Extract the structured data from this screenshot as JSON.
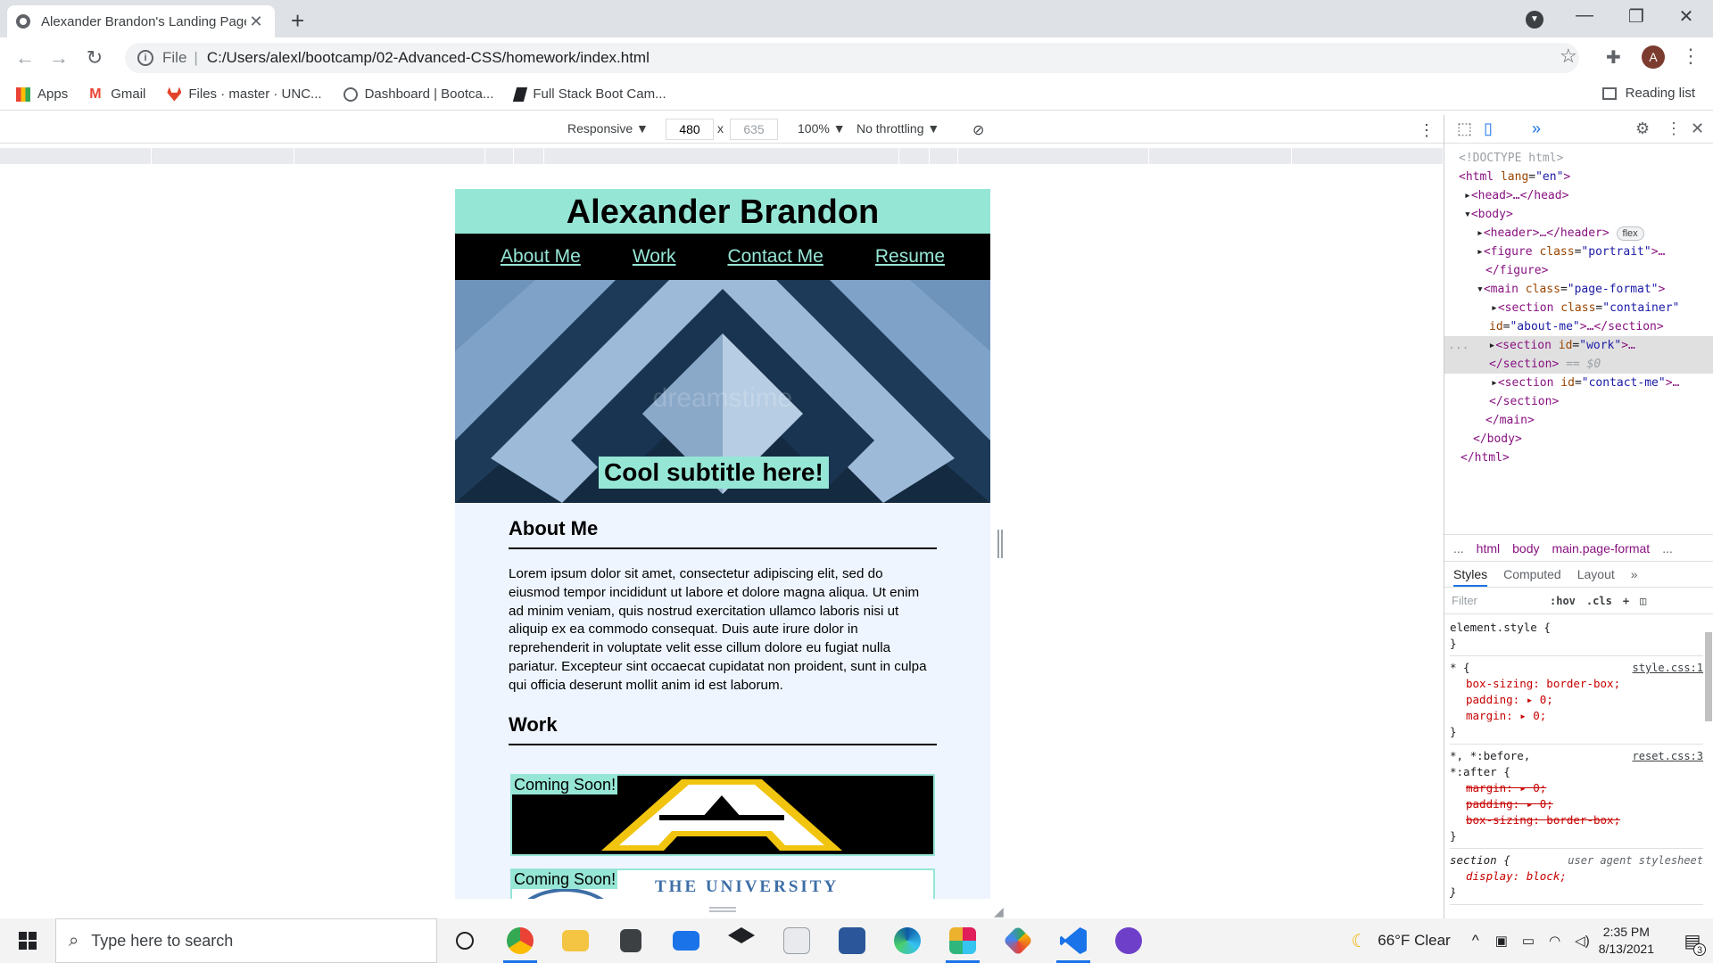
{
  "browser": {
    "tab_title": "Alexander Brandon's Landing Page",
    "url_scheme": "File",
    "url": "C:/Users/alexl/bootcamp/02-Advanced-CSS/homework/index.html",
    "avatar_letter": "A"
  },
  "bookmarks": {
    "items": [
      "Apps",
      "Gmail",
      "Files · master · UNC...",
      "Dashboard | Bootca...",
      "Full Stack Boot Cam..."
    ],
    "reading_list": "Reading list"
  },
  "device_toolbar": {
    "mode": "Responsive ▼",
    "width": "480",
    "height": "635",
    "times": "x",
    "zoom": "100% ▼",
    "throttle": "No throttling ▼"
  },
  "site": {
    "name": "Alexander Brandon",
    "nav": [
      "About Me",
      "Work",
      "Contact Me",
      "Resume"
    ],
    "subtitle": "Cool subtitle here!",
    "about_title": "About Me",
    "about_text": "Lorem ipsum dolor sit amet, consectetur adipiscing elit, sed do eiusmod tempor incididunt ut labore et dolore magna aliqua. Ut enim ad minim veniam, quis nostrud exercitation ullamco laboris nisi ut aliquip ex ea commodo consequat. Duis aute irure dolor in reprehenderit in voluptate velit esse cillum dolore eu fugiat nulla pariatur. Excepteur sint occaecat cupidatat non proident, sunt in culpa qui officia deserunt mollit anim id est laborum.",
    "work_title": "Work",
    "cards": [
      "Coming Soon!",
      "Coming Soon!"
    ],
    "card2_text": "THE UNIVERSITY",
    "watermark": "dreamstime"
  },
  "devtools": {
    "more_tabs": "»",
    "dom": {
      "doctype": "<!DOCTYPE html>",
      "html_open": "<html",
      "lang_attr": "lang",
      "lang_val": "\"en\"",
      "head": "<head>…</head>",
      "body_open": "<body>",
      "header": "<header>…</header>",
      "flex_badge": "flex",
      "figure_open": "<figure",
      "class_attr": "class",
      "portrait_val": "\"portrait\"",
      "figure_rest": ">…",
      "figure_close": "</figure>",
      "main_open": "<main",
      "page_format_val": "\"page-format\"",
      "gt": ">",
      "section_open": "<section",
      "container_val": "\"container\"",
      "id_attr": "id",
      "about_me_val": "\"about-me\"",
      "section_rest_close": ">…</section>",
      "work_val": "\"work\"",
      "ellipsis_gt": ">…",
      "section_close": "</section>",
      "eq_marker": "== $0",
      "contact_val": "\"contact-me\"",
      "main_close": "</main>",
      "body_close": "</body>",
      "html_close": "</html>",
      "dots": "..."
    },
    "breadcrumbs": [
      "...",
      "html",
      "body",
      "main.page-format",
      "..."
    ],
    "tabs": [
      "Styles",
      "Computed",
      "Layout",
      "»"
    ],
    "filter_placeholder": "Filter",
    "filter_buttons": [
      ":hov",
      ".cls",
      "+"
    ],
    "styles": {
      "element_style": "element.style {",
      "close": "}",
      "rule1_selector": "* {",
      "rule1_src": "style.css:1",
      "rule1_props": [
        "box-sizing: border-box;",
        "padding: ▸ 0;",
        "margin: ▸ 0;"
      ],
      "rule2_selector": "*, *:before,",
      "rule2_selector2": "*:after {",
      "rule2_src": "reset.css:3",
      "rule2_props": [
        "margin: ▸ 0;",
        "padding: ▸ 0;",
        "box-sizing: border-box;"
      ],
      "rule3_selector": "section {",
      "rule3_src": "user agent stylesheet",
      "rule3_props": [
        "display: block;"
      ]
    }
  },
  "taskbar": {
    "search_placeholder": "Type here to search",
    "weather": "66°F  Clear",
    "time": "2:35 PM",
    "date": "8/13/2021",
    "notification_count": "3"
  }
}
